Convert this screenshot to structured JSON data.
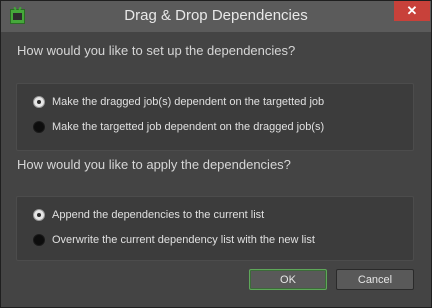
{
  "window": {
    "title": "Drag & Drop Dependencies",
    "close_label": "✕"
  },
  "setup": {
    "question": "How would you like to set up the dependencies?",
    "options": [
      {
        "label": "Make the dragged job(s) dependent on the targetted job",
        "checked": true
      },
      {
        "label": "Make the targetted job dependent on the dragged job(s)",
        "checked": false
      }
    ]
  },
  "apply": {
    "question": "How would you like to apply the dependencies?",
    "options": [
      {
        "label": "Append the dependencies to the current list",
        "checked": true
      },
      {
        "label": "Overwrite the current dependency list with the new list",
        "checked": false
      }
    ]
  },
  "buttons": {
    "ok_label": "OK",
    "cancel_label": "Cancel"
  },
  "colors": {
    "window_bg": "#444444",
    "titlebar_bg": "#5b5b5b",
    "close_bg": "#c8413a",
    "ok_border": "#5fa75a",
    "app_icon": "#45a83a"
  }
}
